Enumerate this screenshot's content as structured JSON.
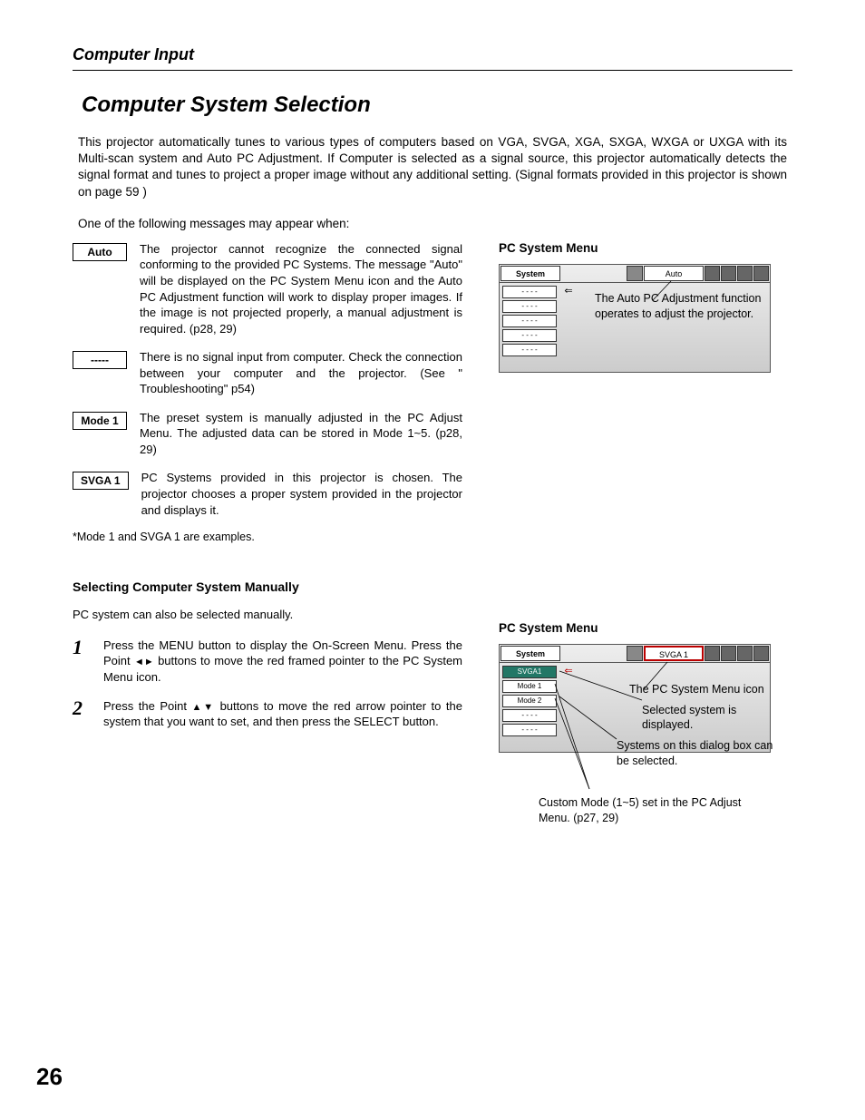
{
  "header": "Computer Input",
  "title": "Computer System Selection",
  "intro": "This projector automatically tunes to various types of computers based on VGA, SVGA, XGA, SXGA, WXGA or UXGA with its Multi-scan system and Auto PC Adjustment.  If Computer is selected as a signal source, this projector automatically detects the signal format and tunes to project a proper image without any additional setting.  (Signal formats provided in this projector is shown on page 59 )",
  "subintro": "One of the following messages may appear when:",
  "messages": [
    {
      "label": "Auto",
      "text": "The projector cannot recognize the connected signal conforming to the provided PC Systems.  The message \"Auto\" will be displayed on the PC System Menu icon and the Auto PC Adjustment function will work to display proper images.  If the image is not projected properly, a manual adjustment is required.  (p28, 29)"
    },
    {
      "label": "-----",
      "text": "There is no signal input from computer.  Check the connection between your computer and the projector.  (See \" Troubleshooting\" p54)"
    },
    {
      "label": "Mode 1",
      "text": "The preset system is manually adjusted in the PC Adjust Menu.  The adjusted data can be stored in Mode 1~5.  (p28, 29)"
    },
    {
      "label": "SVGA 1",
      "text": "PC Systems provided in this projector is chosen.  The projector chooses a proper system provided in the projector and displays it."
    }
  ],
  "footnote": "*Mode 1 and SVGA 1 are examples.",
  "manual_heading": "Selecting Computer System Manually",
  "manual_intro": "PC system can also be selected manually.",
  "steps": [
    {
      "num": "1",
      "pre": "Press the MENU button to display the On-Screen Menu.  Press the Point ",
      "glyph": "◄►",
      "post": " buttons to move the red framed pointer to the PC System Menu icon."
    },
    {
      "num": "2",
      "pre": "Press the Point ",
      "glyph": "▲▼",
      "post": " buttons to move the red arrow pointer to the system that you want to set, and then press the SELECT button."
    }
  ],
  "fig1": {
    "title": "PC System Menu",
    "system_label": "System",
    "top_label": "Auto",
    "items": [
      "- - - -",
      "- - - -",
      "- - - -",
      "- - - -",
      "- - - -"
    ],
    "desc": "The Auto PC Adjustment function operates to adjust the projector."
  },
  "fig2": {
    "title": "PC System Menu",
    "system_label": "System",
    "top_label": "SVGA 1",
    "items": [
      "SVGA1",
      "Mode 1",
      "Mode 2",
      "- - - -",
      "- - - -"
    ],
    "callout_icon": "The PC System Menu icon",
    "callout_sel": "Selected system is displayed.",
    "callout_list": "Systems on this dialog box can be selected.",
    "callout_custom": "Custom Mode (1~5) set in the PC Adjust Menu.  (p27, 29)"
  },
  "page_number": "26"
}
